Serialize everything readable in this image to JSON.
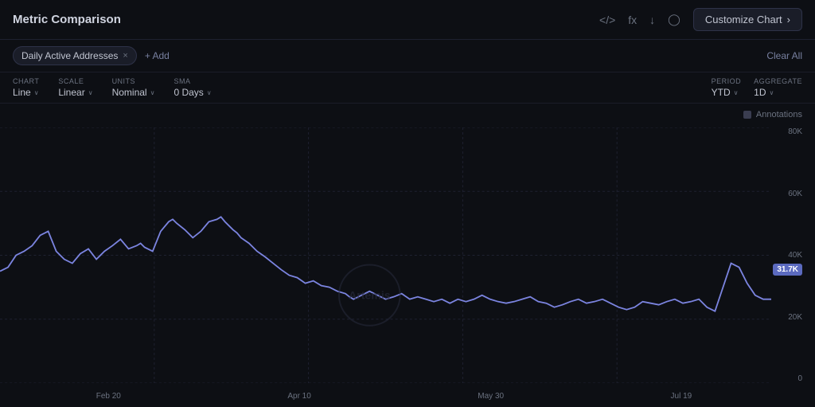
{
  "header": {
    "title": "Metric Comparison",
    "icons": [
      "code-icon",
      "formula-icon",
      "download-icon",
      "camera-icon"
    ],
    "customize_btn": "Customize Chart",
    "customize_chevron": "›"
  },
  "toolbar": {
    "metric_tag": "Daily Active Addresses",
    "close_label": "×",
    "add_label": "+ Add",
    "clear_all_label": "Clear All"
  },
  "controls": {
    "chart": {
      "label": "CHART",
      "value": "Line",
      "chevron": "∨"
    },
    "scale": {
      "label": "SCALE",
      "value": "Linear",
      "chevron": "∨"
    },
    "units": {
      "label": "UNITS",
      "value": "Nominal",
      "chevron": "∨"
    },
    "sma": {
      "label": "SMA",
      "value": "0 Days",
      "chevron": "∨"
    },
    "period": {
      "label": "PERIOD",
      "value": "YTD",
      "chevron": "∨"
    },
    "aggregate": {
      "label": "AGGREGATE",
      "value": "1D",
      "chevron": "∨"
    }
  },
  "chart": {
    "annotations_label": "Annotations",
    "current_value": "31.7K",
    "y_axis": [
      "80K",
      "60K",
      "40K",
      "20K",
      "0"
    ],
    "x_axis": [
      "Feb 20",
      "Apr 10",
      "May 30",
      "Jul 19"
    ],
    "colors": {
      "line": "#7b84e0",
      "grid": "#1e2130",
      "badge": "#5b6abf"
    }
  }
}
